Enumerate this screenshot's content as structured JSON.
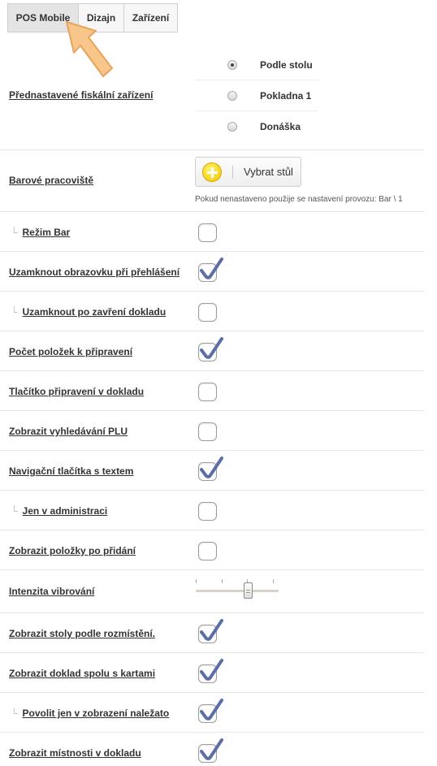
{
  "tabs": [
    {
      "label": "POS Mobile",
      "active": true
    },
    {
      "label": "Dizajn",
      "active": false
    },
    {
      "label": "Zařízení",
      "active": false
    }
  ],
  "fiscal": {
    "label": "Přednastavené fiskální zařízení",
    "options": [
      {
        "label": "Podle stolu",
        "checked": true
      },
      {
        "label": "Pokladna 1",
        "checked": false
      },
      {
        "label": "Donáška",
        "checked": false
      }
    ]
  },
  "bar": {
    "label": "Barové pracoviště",
    "button_label": "Vybrat stůl",
    "hint": "Pokud nenastaveno použije se nastavení provozu: Bar \\ 1"
  },
  "settings": [
    {
      "label": "Režim Bar",
      "sub": true,
      "checked": false
    },
    {
      "label": "Uzamknout obrazovku při přehlášení",
      "sub": false,
      "checked": true
    },
    {
      "label": "Uzamknout po zavření dokladu",
      "sub": true,
      "checked": false
    },
    {
      "label": "Počet položek k připravení",
      "sub": false,
      "checked": true
    },
    {
      "label": "Tlačítko připravení v dokladu",
      "sub": false,
      "checked": false
    },
    {
      "label": "Zobrazit vyhledávání PLU",
      "sub": false,
      "checked": false
    },
    {
      "label": "Navigační tlačítka s textem",
      "sub": false,
      "checked": true
    },
    {
      "label": "Jen v administraci",
      "sub": true,
      "checked": false
    },
    {
      "label": "Zobrazit položky po přidání",
      "sub": false,
      "checked": false
    }
  ],
  "vibration": {
    "label": "Intenzita vibrování",
    "level": 0.65
  },
  "settings2": [
    {
      "label": "Zobrazit stoly podle rozmístění.",
      "sub": false,
      "checked": true
    },
    {
      "label": "Zobrazit doklad spolu s kartami",
      "sub": false,
      "checked": true
    },
    {
      "label": "Povolit jen v zobrazení naležato",
      "sub": true,
      "checked": true
    },
    {
      "label": "Zobrazit místnosti v dokladu",
      "sub": false,
      "checked": true
    }
  ],
  "sub_marker": "└",
  "colors": {
    "check": "#5b6ea8",
    "arrow_fill": "#f8c58a",
    "arrow_stroke": "#e8a45a",
    "plus_icon": "#f2cc00"
  }
}
